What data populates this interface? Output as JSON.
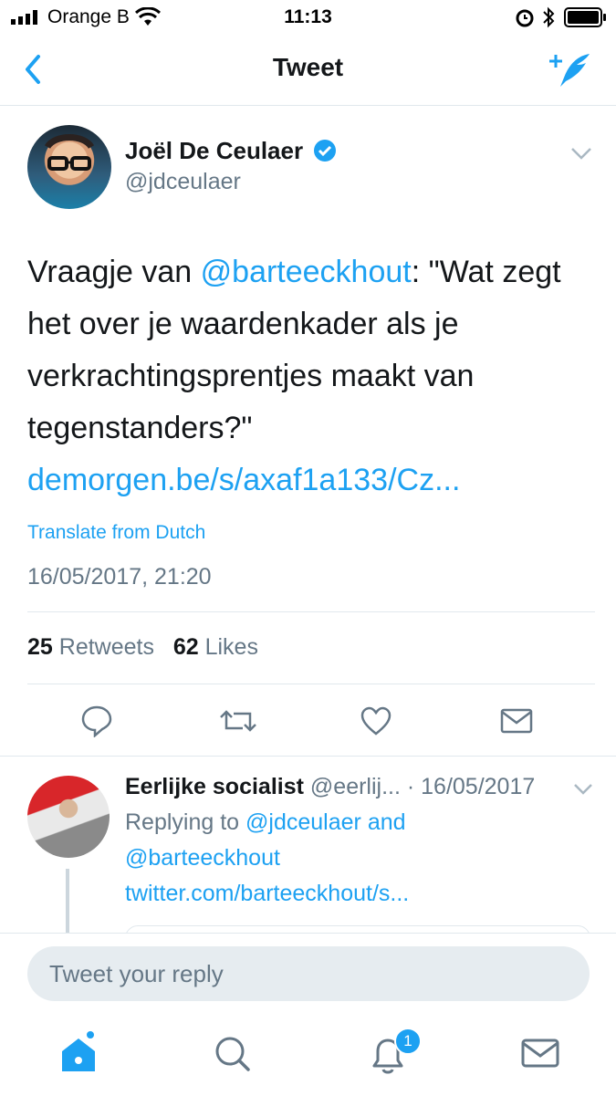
{
  "status_bar": {
    "carrier": "Orange B",
    "time": "11:13"
  },
  "nav": {
    "title": "Tweet"
  },
  "tweet": {
    "author_name": "Joël De Ceulaer",
    "author_handle": "@jdceulaer",
    "verified": true,
    "text_prefix": "Vraagje van ",
    "mention": "@barteeckhout",
    "text_body": ": \"Wat zegt het over je waardenkader als je verkrachtingsprentjes maakt van tegenstanders?\" ",
    "link": "demorgen.be/s/axaf1a133/Cz...",
    "translate_label": "Translate from Dutch",
    "timestamp": "16/05/2017, 21:20",
    "retweets_count": "25",
    "retweets_label": "Retweets",
    "likes_count": "62",
    "likes_label": "Likes"
  },
  "reply": {
    "author_name": "Eerlijke socialist",
    "author_handle": "@eerlij...",
    "date": "· 16/05/2017",
    "replying_prefix": "Replying to ",
    "replying_mention1": "@jdceulaer",
    "replying_and": " and",
    "replying_mention2": "@barteeckhout",
    "link": "twitter.com/barteeckhout/s..."
  },
  "composer": {
    "placeholder": "Tweet your reply"
  },
  "tab_bar": {
    "notifications_badge": "1"
  },
  "colors": {
    "accent": "#1da1f2",
    "secondary_text": "#657786",
    "divider": "#e1e8ed"
  }
}
